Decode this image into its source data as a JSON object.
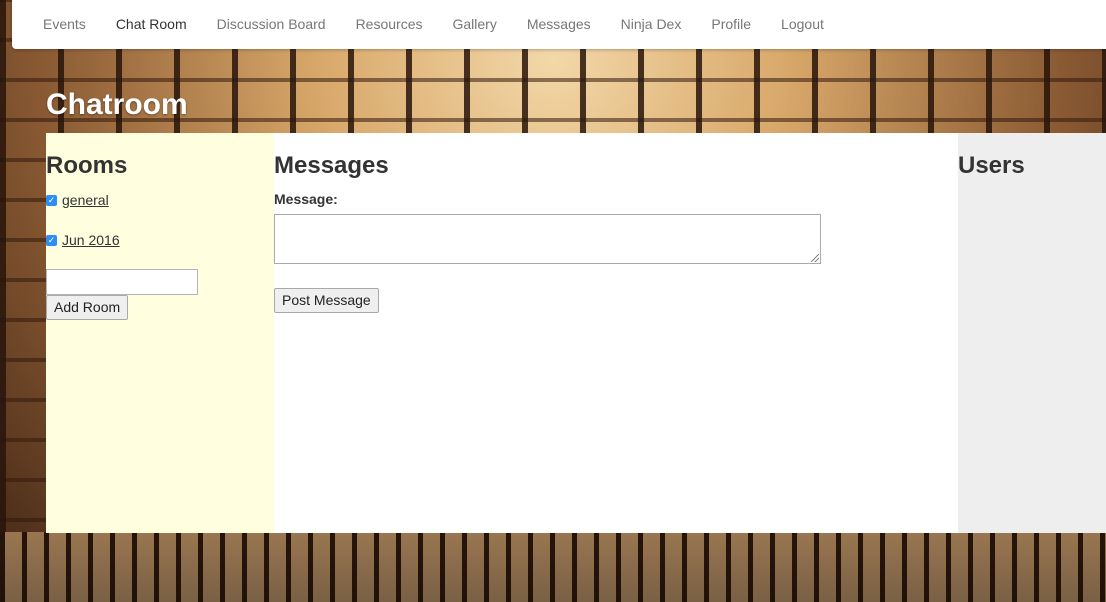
{
  "nav": {
    "items": [
      {
        "label": "Events"
      },
      {
        "label": "Chat Room",
        "active": true
      },
      {
        "label": "Discussion Board"
      },
      {
        "label": "Resources"
      },
      {
        "label": "Gallery"
      },
      {
        "label": "Messages"
      },
      {
        "label": "Ninja Dex"
      },
      {
        "label": "Profile"
      },
      {
        "label": "Logout"
      }
    ]
  },
  "page": {
    "title": "Chatroom"
  },
  "rooms": {
    "heading": "Rooms",
    "items": [
      {
        "label": "general",
        "checked": true
      },
      {
        "label": "Jun 2016",
        "checked": true
      }
    ],
    "new_room_value": "",
    "add_button": "Add Room"
  },
  "messages": {
    "heading": "Messages",
    "label": "Message:",
    "input_value": "",
    "post_button": "Post Message"
  },
  "users": {
    "heading": "Users"
  },
  "colors": {
    "rooms_panel_bg": "#ffffe0",
    "messages_panel_bg": "#ffffff",
    "users_panel_bg": "#eeeeee",
    "checkbox_accent": "#2f8ef5"
  }
}
